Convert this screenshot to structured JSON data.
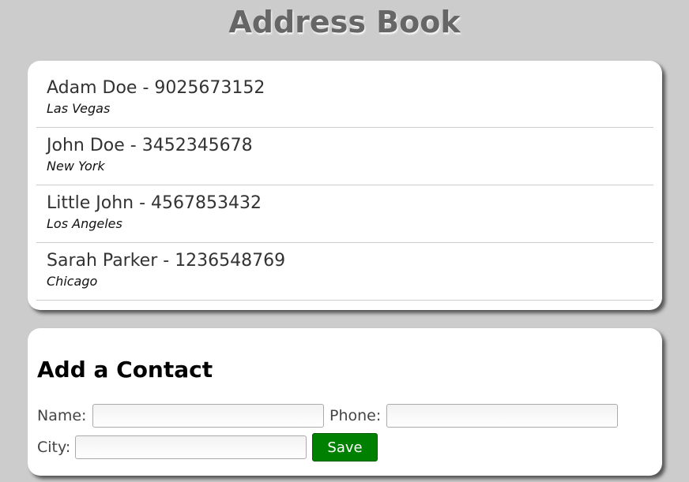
{
  "app": {
    "title": "Address Book"
  },
  "contacts": [
    {
      "name": "Adam Doe",
      "phone": "9025673152",
      "city": "Las Vegas"
    },
    {
      "name": "John Doe",
      "phone": "3452345678",
      "city": "New York"
    },
    {
      "name": "Little John",
      "phone": "4567853432",
      "city": "Los Angeles"
    },
    {
      "name": "Sarah Parker",
      "phone": "1236548769",
      "city": "Chicago"
    }
  ],
  "form": {
    "title": "Add a Contact",
    "name_label": "Name:",
    "name_value": "",
    "phone_label": "Phone:",
    "phone_value": "",
    "city_label": "City:",
    "city_value": "",
    "save_label": "Save"
  },
  "colors": {
    "background": "#cccccc",
    "card": "#ffffff",
    "title": "#666666",
    "save_button": "#008000"
  }
}
